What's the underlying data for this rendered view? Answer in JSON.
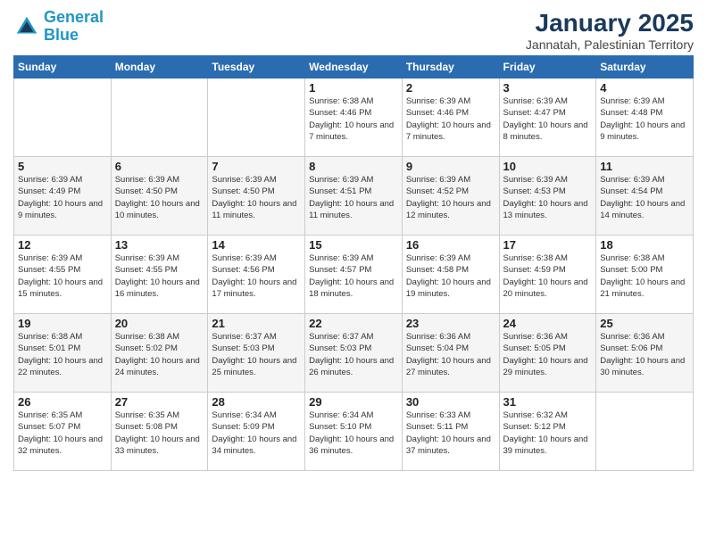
{
  "logo": {
    "line1": "General",
    "line2": "Blue"
  },
  "title": "January 2025",
  "subtitle": "Jannatah, Palestinian Territory",
  "weekdays": [
    "Sunday",
    "Monday",
    "Tuesday",
    "Wednesday",
    "Thursday",
    "Friday",
    "Saturday"
  ],
  "weeks": [
    [
      {
        "day": "",
        "sunrise": "",
        "sunset": "",
        "daylight": ""
      },
      {
        "day": "",
        "sunrise": "",
        "sunset": "",
        "daylight": ""
      },
      {
        "day": "",
        "sunrise": "",
        "sunset": "",
        "daylight": ""
      },
      {
        "day": "1",
        "sunrise": "Sunrise: 6:38 AM",
        "sunset": "Sunset: 4:46 PM",
        "daylight": "Daylight: 10 hours and 7 minutes."
      },
      {
        "day": "2",
        "sunrise": "Sunrise: 6:39 AM",
        "sunset": "Sunset: 4:46 PM",
        "daylight": "Daylight: 10 hours and 7 minutes."
      },
      {
        "day": "3",
        "sunrise": "Sunrise: 6:39 AM",
        "sunset": "Sunset: 4:47 PM",
        "daylight": "Daylight: 10 hours and 8 minutes."
      },
      {
        "day": "4",
        "sunrise": "Sunrise: 6:39 AM",
        "sunset": "Sunset: 4:48 PM",
        "daylight": "Daylight: 10 hours and 9 minutes."
      }
    ],
    [
      {
        "day": "5",
        "sunrise": "Sunrise: 6:39 AM",
        "sunset": "Sunset: 4:49 PM",
        "daylight": "Daylight: 10 hours and 9 minutes."
      },
      {
        "day": "6",
        "sunrise": "Sunrise: 6:39 AM",
        "sunset": "Sunset: 4:50 PM",
        "daylight": "Daylight: 10 hours and 10 minutes."
      },
      {
        "day": "7",
        "sunrise": "Sunrise: 6:39 AM",
        "sunset": "Sunset: 4:50 PM",
        "daylight": "Daylight: 10 hours and 11 minutes."
      },
      {
        "day": "8",
        "sunrise": "Sunrise: 6:39 AM",
        "sunset": "Sunset: 4:51 PM",
        "daylight": "Daylight: 10 hours and 11 minutes."
      },
      {
        "day": "9",
        "sunrise": "Sunrise: 6:39 AM",
        "sunset": "Sunset: 4:52 PM",
        "daylight": "Daylight: 10 hours and 12 minutes."
      },
      {
        "day": "10",
        "sunrise": "Sunrise: 6:39 AM",
        "sunset": "Sunset: 4:53 PM",
        "daylight": "Daylight: 10 hours and 13 minutes."
      },
      {
        "day": "11",
        "sunrise": "Sunrise: 6:39 AM",
        "sunset": "Sunset: 4:54 PM",
        "daylight": "Daylight: 10 hours and 14 minutes."
      }
    ],
    [
      {
        "day": "12",
        "sunrise": "Sunrise: 6:39 AM",
        "sunset": "Sunset: 4:55 PM",
        "daylight": "Daylight: 10 hours and 15 minutes."
      },
      {
        "day": "13",
        "sunrise": "Sunrise: 6:39 AM",
        "sunset": "Sunset: 4:55 PM",
        "daylight": "Daylight: 10 hours and 16 minutes."
      },
      {
        "day": "14",
        "sunrise": "Sunrise: 6:39 AM",
        "sunset": "Sunset: 4:56 PM",
        "daylight": "Daylight: 10 hours and 17 minutes."
      },
      {
        "day": "15",
        "sunrise": "Sunrise: 6:39 AM",
        "sunset": "Sunset: 4:57 PM",
        "daylight": "Daylight: 10 hours and 18 minutes."
      },
      {
        "day": "16",
        "sunrise": "Sunrise: 6:39 AM",
        "sunset": "Sunset: 4:58 PM",
        "daylight": "Daylight: 10 hours and 19 minutes."
      },
      {
        "day": "17",
        "sunrise": "Sunrise: 6:38 AM",
        "sunset": "Sunset: 4:59 PM",
        "daylight": "Daylight: 10 hours and 20 minutes."
      },
      {
        "day": "18",
        "sunrise": "Sunrise: 6:38 AM",
        "sunset": "Sunset: 5:00 PM",
        "daylight": "Daylight: 10 hours and 21 minutes."
      }
    ],
    [
      {
        "day": "19",
        "sunrise": "Sunrise: 6:38 AM",
        "sunset": "Sunset: 5:01 PM",
        "daylight": "Daylight: 10 hours and 22 minutes."
      },
      {
        "day": "20",
        "sunrise": "Sunrise: 6:38 AM",
        "sunset": "Sunset: 5:02 PM",
        "daylight": "Daylight: 10 hours and 24 minutes."
      },
      {
        "day": "21",
        "sunrise": "Sunrise: 6:37 AM",
        "sunset": "Sunset: 5:03 PM",
        "daylight": "Daylight: 10 hours and 25 minutes."
      },
      {
        "day": "22",
        "sunrise": "Sunrise: 6:37 AM",
        "sunset": "Sunset: 5:03 PM",
        "daylight": "Daylight: 10 hours and 26 minutes."
      },
      {
        "day": "23",
        "sunrise": "Sunrise: 6:36 AM",
        "sunset": "Sunset: 5:04 PM",
        "daylight": "Daylight: 10 hours and 27 minutes."
      },
      {
        "day": "24",
        "sunrise": "Sunrise: 6:36 AM",
        "sunset": "Sunset: 5:05 PM",
        "daylight": "Daylight: 10 hours and 29 minutes."
      },
      {
        "day": "25",
        "sunrise": "Sunrise: 6:36 AM",
        "sunset": "Sunset: 5:06 PM",
        "daylight": "Daylight: 10 hours and 30 minutes."
      }
    ],
    [
      {
        "day": "26",
        "sunrise": "Sunrise: 6:35 AM",
        "sunset": "Sunset: 5:07 PM",
        "daylight": "Daylight: 10 hours and 32 minutes."
      },
      {
        "day": "27",
        "sunrise": "Sunrise: 6:35 AM",
        "sunset": "Sunset: 5:08 PM",
        "daylight": "Daylight: 10 hours and 33 minutes."
      },
      {
        "day": "28",
        "sunrise": "Sunrise: 6:34 AM",
        "sunset": "Sunset: 5:09 PM",
        "daylight": "Daylight: 10 hours and 34 minutes."
      },
      {
        "day": "29",
        "sunrise": "Sunrise: 6:34 AM",
        "sunset": "Sunset: 5:10 PM",
        "daylight": "Daylight: 10 hours and 36 minutes."
      },
      {
        "day": "30",
        "sunrise": "Sunrise: 6:33 AM",
        "sunset": "Sunset: 5:11 PM",
        "daylight": "Daylight: 10 hours and 37 minutes."
      },
      {
        "day": "31",
        "sunrise": "Sunrise: 6:32 AM",
        "sunset": "Sunset: 5:12 PM",
        "daylight": "Daylight: 10 hours and 39 minutes."
      },
      {
        "day": "",
        "sunrise": "",
        "sunset": "",
        "daylight": ""
      }
    ]
  ]
}
